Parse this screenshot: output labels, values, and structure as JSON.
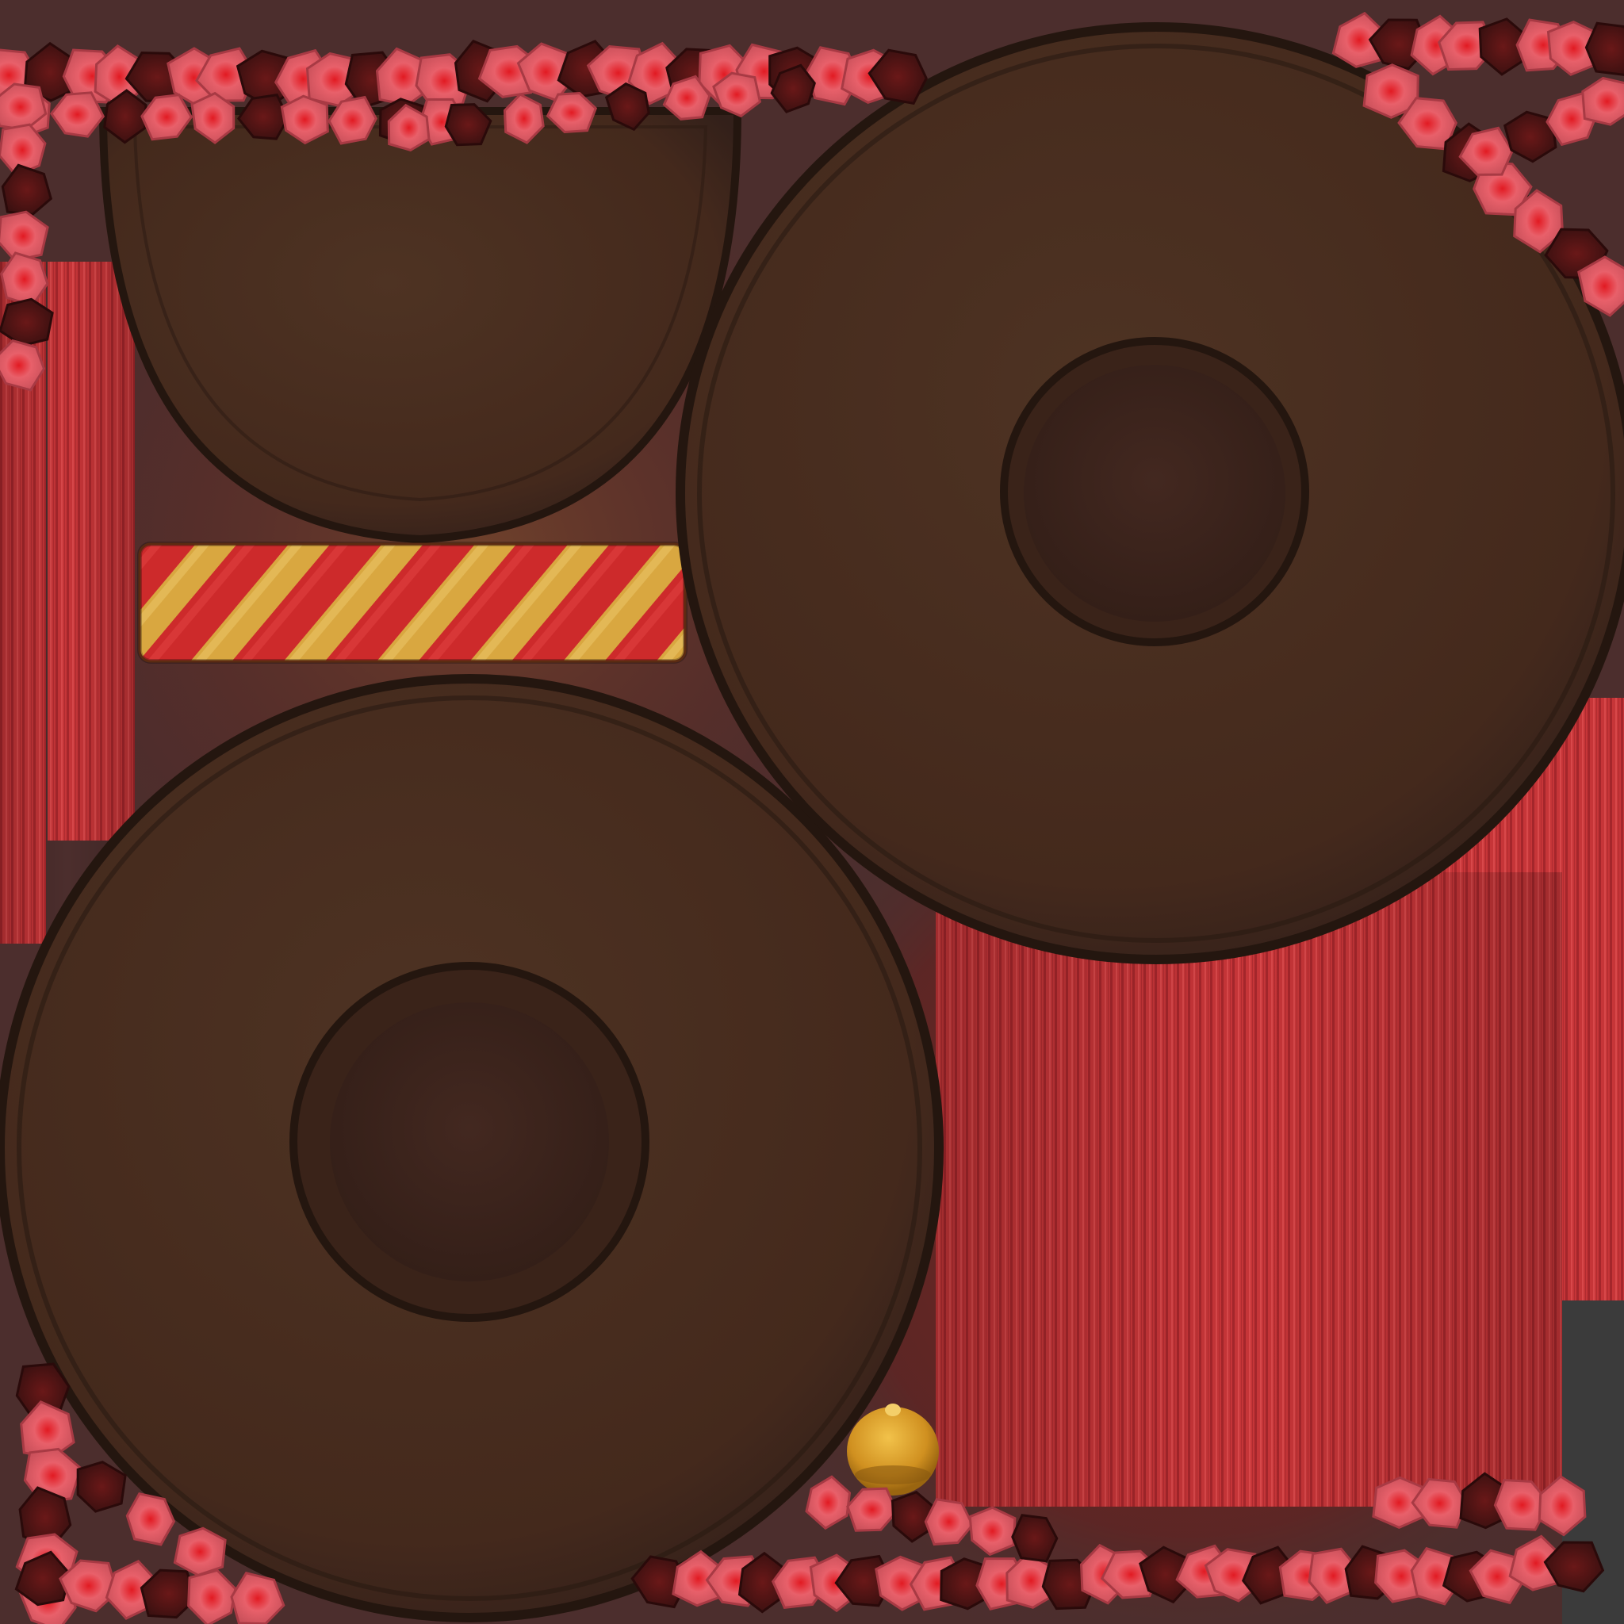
{
  "texture_atlas": {
    "colors": {
      "background": "#3b3b3b",
      "glow": "#8a1a1a",
      "felt_brown": "#4a3020",
      "felt_dark": "#2f1d14",
      "felt_edge": "#24160f",
      "crown_brown": "#3d241b",
      "fabric_red": "#c8373a",
      "fabric_shadow": "#8e1f24",
      "ribbon_red": "#cc2a2a",
      "ribbon_gold": "#d6a43a",
      "bell_gold": "#d9a02a",
      "flower_pink": "#e9707a",
      "flower_red": "#e21a22",
      "flower_dark": "#4a1414"
    },
    "icons": {
      "felt_piece": "hat-brim-felt",
      "fabric_panel": "red-pleated-fabric",
      "ribbon": "striped-ribbon",
      "bell": "gold-bell",
      "flower": "flower-bead"
    }
  }
}
